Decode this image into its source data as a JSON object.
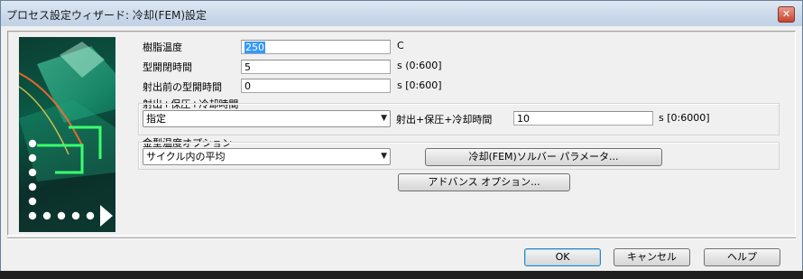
{
  "window": {
    "title": "プロセス設定ウィザード: 冷却(FEM)設定",
    "close_glyph": "✕"
  },
  "form": {
    "melt_temp": {
      "label": "樹脂温度",
      "value": "250",
      "unit": "C"
    },
    "mold_open_time": {
      "label": "型開閉時間",
      "value": "5",
      "unit": "s (0:600]"
    },
    "open_time_before_injection": {
      "label": "射出前の型開時間",
      "value": "0",
      "unit": "s [0:600]"
    },
    "cycle_group": {
      "label": "射出+保圧+冷却時間",
      "combo_value": "指定",
      "field_label": "射出+保圧+冷却時間",
      "value": "10",
      "unit": "s [0:6000]"
    },
    "mold_temp_group": {
      "label": "金型温度オプション",
      "combo_value": "サイクル内の平均",
      "solver_button": "冷却(FEM)ソルバー パラメータ..."
    },
    "advanced_button": "アドバンス オプション..."
  },
  "footer": {
    "ok": "OK",
    "cancel": "キャンセル",
    "help": "ヘルプ"
  },
  "icons": {
    "combo_arrow": "▼"
  }
}
